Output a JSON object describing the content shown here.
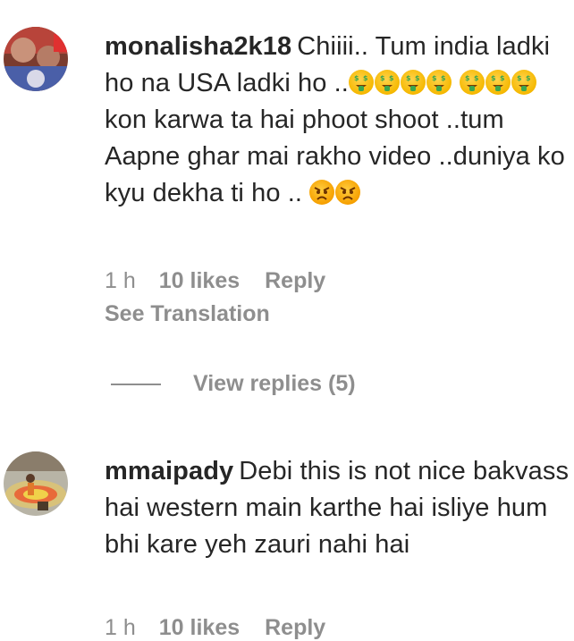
{
  "comments": [
    {
      "username": "monalisha2k18",
      "text_1": "Chiiii.. Tum india ladki ho na USA ladki ho ..",
      "text_2": "kon karwa ta hai phoot shoot ..tum Aapne ghar mai rakho video ..duniya ko kyu dekha ti ho ..",
      "time": "1 h",
      "likes": "10 likes",
      "reply_label": "Reply",
      "see_translation": "See Translation",
      "view_replies": "View replies (5)"
    },
    {
      "username": "mmaipady",
      "text_1": "Debi this is not nice bakvass hai western main karthe hai isliye hum bhi kare yeh zauri nahi hai",
      "time": "1 h",
      "likes": "10 likes",
      "reply_label": "Reply"
    }
  ],
  "icons": {
    "money_face": "money-mouth-face-emoji",
    "angry_face": "angry-face-emoji"
  },
  "colors": {
    "text": "#262626",
    "secondary": "#8e8e8e",
    "emoji_yellow": "#f5b800",
    "money_green": "#3aa650"
  }
}
